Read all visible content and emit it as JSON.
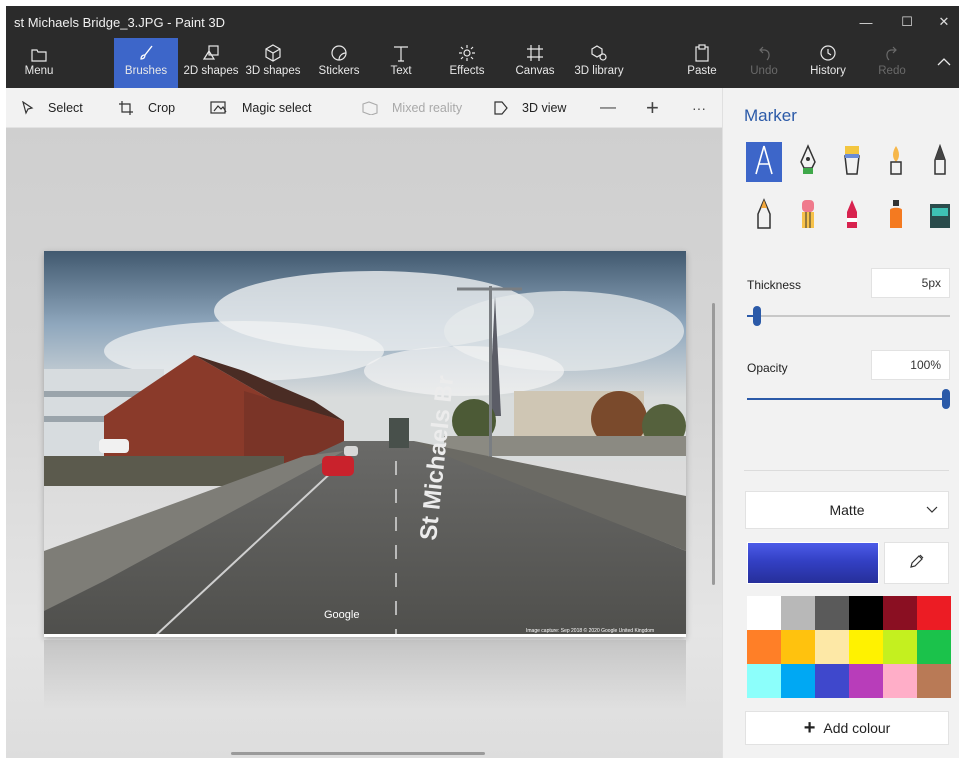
{
  "window": {
    "title": "st Michaels Bridge_3.JPG - Paint 3D",
    "controls": {
      "minimize": "—",
      "maximize": "☐",
      "close": "✕"
    }
  },
  "ribbon": {
    "items": [
      {
        "label": "Menu",
        "icon": "folder-icon"
      },
      {
        "label": "Brushes",
        "icon": "brush-icon",
        "active": true
      },
      {
        "label": "2D shapes",
        "icon": "2d-shapes-icon"
      },
      {
        "label": "3D shapes",
        "icon": "3d-shapes-icon"
      },
      {
        "label": "Stickers",
        "icon": "stickers-icon"
      },
      {
        "label": "Text",
        "icon": "text-icon"
      },
      {
        "label": "Effects",
        "icon": "effects-icon"
      },
      {
        "label": "Canvas",
        "icon": "canvas-icon"
      },
      {
        "label": "3D library",
        "icon": "3d-library-icon"
      },
      {
        "label": "Paste",
        "icon": "paste-icon"
      },
      {
        "label": "Undo",
        "icon": "undo-icon",
        "disabled": true
      },
      {
        "label": "History",
        "icon": "history-icon"
      },
      {
        "label": "Redo",
        "icon": "redo-icon",
        "disabled": true
      }
    ]
  },
  "commandbar": {
    "select": "Select",
    "crop": "Crop",
    "magic_select": "Magic select",
    "mixed_reality": "Mixed reality",
    "view_3d": "3D view",
    "zoom_out": "—",
    "zoom_in": "+",
    "more": "···"
  },
  "canvas": {
    "image": {
      "road_label": "St Michaels Br",
      "watermark": "Google",
      "credit": "Image capture: Sep 2018   © 2020 Google   United Kingdom"
    }
  },
  "panel": {
    "title": "Marker",
    "brushes": [
      "marker-icon",
      "calligraphy-pen-icon",
      "oil-brush-icon",
      "watercolor-icon",
      "pixel-pen-icon",
      "pencil-icon",
      "eraser-icon",
      "crayon-icon",
      "spray-can-icon",
      "fill-icon"
    ],
    "thickness_label": "Thickness",
    "thickness_value": "5px",
    "thickness_level": 0.05,
    "opacity_label": "Opacity",
    "opacity_value": "100%",
    "opacity_level": 1.0,
    "finish": "Matte",
    "current_color": "#3a47d6",
    "add_colour": "Add colour",
    "palette": [
      "#ffffff",
      "#b8b8b8",
      "#5a5a5a",
      "#000000",
      "#8a0f22",
      "#ec1c24",
      "#ff7f27",
      "#ffc20e",
      "#fde8a6",
      "#fff200",
      "#c4f01f",
      "#1bc24b",
      "#8cfffb",
      "#00a8f3",
      "#3f48cc",
      "#b83dba",
      "#ffaec8",
      "#b97a56"
    ]
  },
  "colors": {
    "accent": "#3d66c9",
    "titlebar": "#2b2b2b",
    "panel_title": "#2b5aa8"
  }
}
